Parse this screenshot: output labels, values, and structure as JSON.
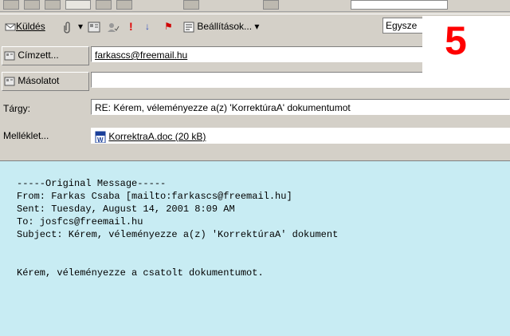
{
  "toolbar": {
    "send": "Küldés",
    "settings": "Beállítások...",
    "font_partial": "Egysze"
  },
  "fields": {
    "to_label": "Címzett...",
    "to_value": "farkascs@freemail.hu",
    "cc_label": "Másolatot",
    "cc_value": "",
    "subject_label": "Tárgy:",
    "subject_value": "RE: Kérem, véleményezze a(z) 'KorrektúraA' dokumentumot",
    "attach_label": "Melléklet...",
    "attach_value": "KorrektraA.doc (20 kB)"
  },
  "badge": "5",
  "message": {
    "header": "-----Original Message-----",
    "from": "From: Farkas Csaba [mailto:farkascs@freemail.hu]",
    "sent": "Sent: Tuesday, August 14, 2001 8:09 AM",
    "to": "To: josfcs@freemail.hu",
    "subject": "Subject: Kérem, véleményezze a(z) 'KorrektúraA' dokument",
    "body": "Kérem, véleményezze a csatolt dokumentumot."
  },
  "colors": {
    "background": "#c8ecf3",
    "window": "#d4d0c8",
    "badge": "#ff0000"
  }
}
